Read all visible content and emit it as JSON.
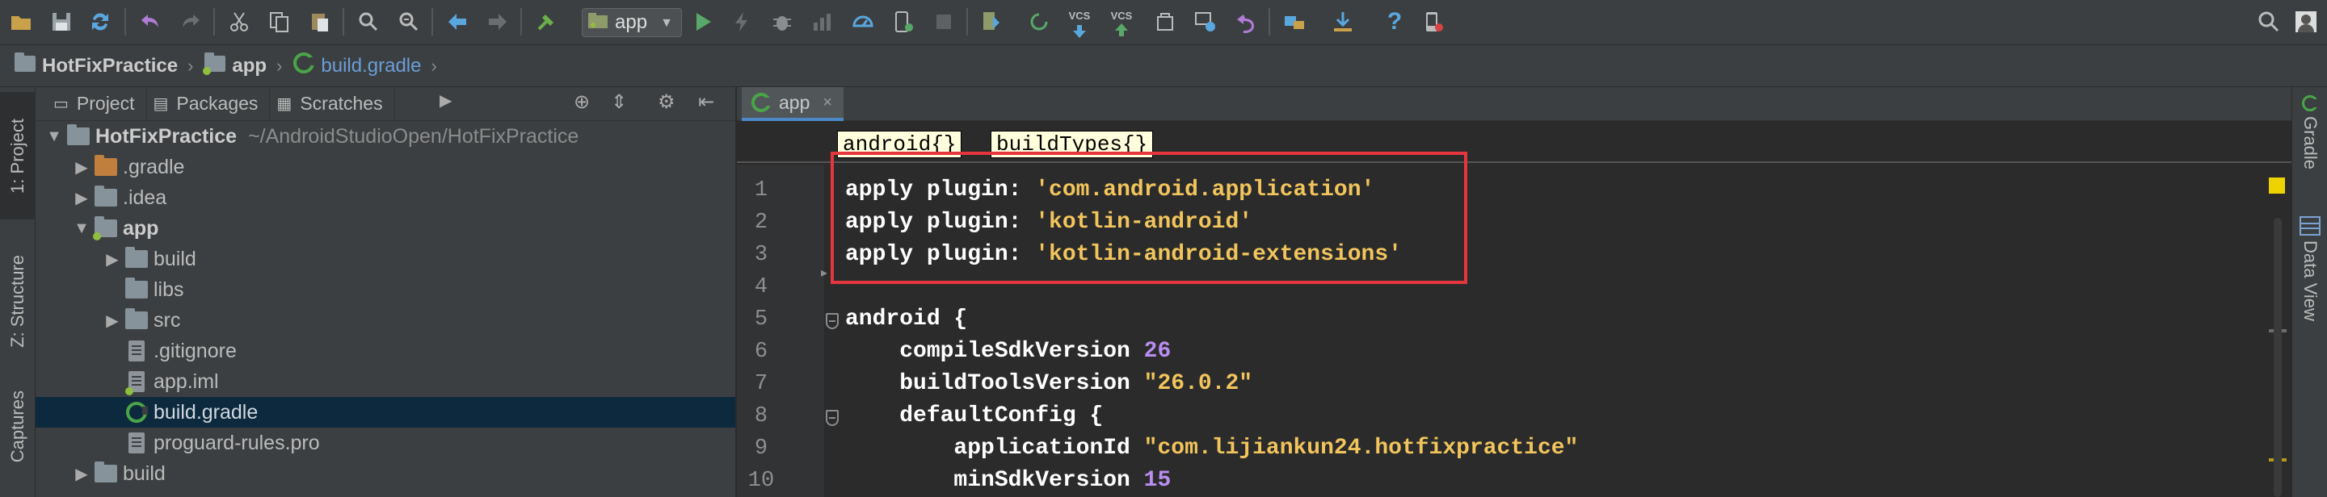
{
  "toolbar": {
    "run_config": "app",
    "vcs_update_label": "VCS",
    "vcs_commit_label": "VCS",
    "icons": [
      "open-folder-icon",
      "save-icon",
      "sync-icon",
      "undo-icon",
      "redo-icon",
      "cut-icon",
      "copy-icon",
      "paste-icon",
      "find-icon",
      "replace-icon",
      "back-icon",
      "forward-icon",
      "build-icon",
      "run-config-icon",
      "run-icon",
      "apply-changes-icon",
      "debug-icon",
      "profile-icon",
      "attach-debugger-icon",
      "stop-icon",
      "gradle-sync-icon",
      "avd-manager-icon",
      "sdk-manager-icon",
      "vcs-update-icon",
      "vcs-commit-icon",
      "vcs-history-icon",
      "vcs-revert-icon",
      "project-structure-icon",
      "deploy-icon",
      "help-icon",
      "device-monitor-icon",
      "search-everywhere-icon",
      "avatar-icon"
    ]
  },
  "breadcrumb": {
    "items": [
      {
        "label": "HotFixPractice",
        "icon": "module-folder-icon"
      },
      {
        "label": "app",
        "icon": "module-folder-icon"
      },
      {
        "label": "build.gradle",
        "icon": "gradle-file-icon"
      }
    ]
  },
  "left_stripe": {
    "tabs": [
      {
        "label": "1: Project"
      },
      {
        "label": "Z: Structure"
      },
      {
        "label": "Captures"
      }
    ]
  },
  "project_panel": {
    "tabs": [
      {
        "label": "Project",
        "icon": "project-view-icon"
      },
      {
        "label": "Packages",
        "icon": "packages-view-icon"
      },
      {
        "label": "Scratches",
        "icon": "scratches-view-icon"
      }
    ],
    "tree": [
      {
        "name": "HotFixPractice",
        "path": "~/AndroidStudioOpen/HotFixPractice",
        "depth": 0,
        "expanded": true,
        "kind": "module"
      },
      {
        "name": ".gradle",
        "depth": 1,
        "expanded": false,
        "kind": "folder-orange"
      },
      {
        "name": ".idea",
        "depth": 1,
        "expanded": false,
        "kind": "folder"
      },
      {
        "name": "app",
        "depth": 1,
        "expanded": true,
        "kind": "module"
      },
      {
        "name": "build",
        "depth": 2,
        "expanded": false,
        "kind": "folder"
      },
      {
        "name": "libs",
        "depth": 2,
        "expanded": null,
        "kind": "folder"
      },
      {
        "name": "src",
        "depth": 2,
        "expanded": false,
        "kind": "folder"
      },
      {
        "name": ".gitignore",
        "depth": 2,
        "kind": "file"
      },
      {
        "name": "app.iml",
        "depth": 2,
        "kind": "file-module"
      },
      {
        "name": "build.gradle",
        "depth": 2,
        "kind": "gradle",
        "selected": true
      },
      {
        "name": "proguard-rules.pro",
        "depth": 2,
        "kind": "file"
      },
      {
        "name": "build",
        "depth": 1,
        "expanded": false,
        "kind": "folder"
      }
    ]
  },
  "editor": {
    "tab_label": "app",
    "tab_close": "×",
    "scope_chips": [
      "android{}",
      "buildTypes{}"
    ],
    "line_numbers": [
      "1",
      "2",
      "3",
      "4",
      "5",
      "6",
      "7",
      "8",
      "9",
      "10"
    ],
    "lines": {
      "l1": {
        "kw": "apply plugin: ",
        "str": "'com.android.application'"
      },
      "l2": {
        "kw": "apply plugin: ",
        "str": "'kotlin-android'"
      },
      "l3": {
        "kw": "apply plugin: ",
        "str": "'kotlin-android-extensions'"
      },
      "l5": {
        "kw": "android {"
      },
      "l6": {
        "kw": "    compileSdkVersion ",
        "num": "26"
      },
      "l7": {
        "kw": "    buildToolsVersion ",
        "str": "\"26.0.2\""
      },
      "l8": {
        "kw": "    defaultConfig {"
      },
      "l9": {
        "kw": "        applicationId ",
        "str": "\"com.lijiankun24.hotfixpractice\""
      },
      "l10": {
        "kw": "        minSdkVersion ",
        "num": "15"
      }
    }
  },
  "right_stripe": {
    "tabs": [
      {
        "label": "Gradle"
      },
      {
        "label": "Data View"
      }
    ]
  },
  "colors": {
    "keyword": "#ffffff",
    "string": "#f2c55c",
    "number": "#b98ef0",
    "highlight_box": "#e5363d",
    "selected_row": "#0d293e"
  }
}
